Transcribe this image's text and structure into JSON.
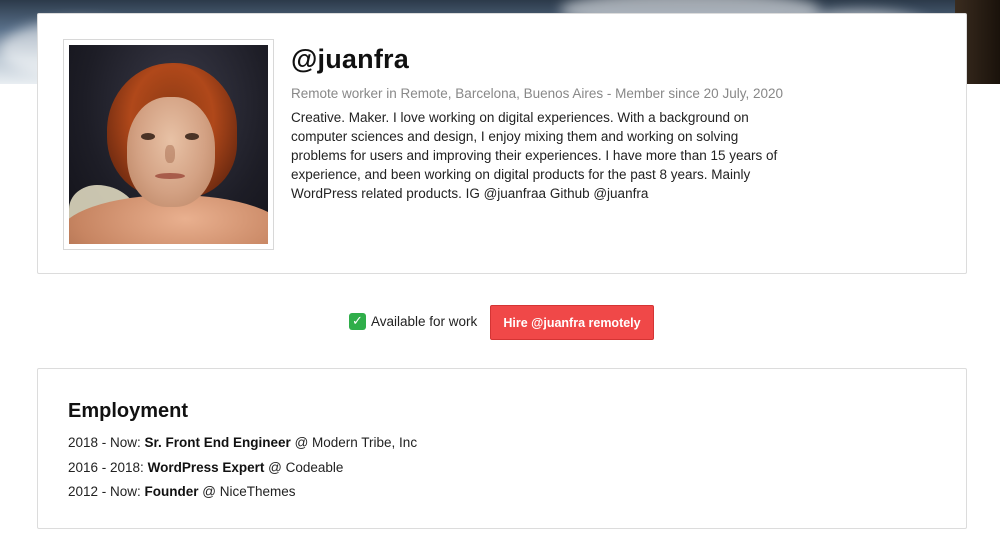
{
  "profile": {
    "username": "@juanfra",
    "meta": "Remote worker in Remote, Barcelona, Buenos Aires - Member since 20 July, 2020",
    "bio": "Creative. Maker. I love working on digital experiences. With a background on computer sciences and design, I enjoy mixing them and working on solving problems for users and improving their experiences. I have more than 15 years of experience, and been working on digital products for the past 8 years. Mainly WordPress related products. IG @juanfraa Github @juanfra"
  },
  "hire": {
    "availability_icon": "check-icon",
    "availability_label": "Available for work",
    "button_label": "Hire @juanfra remotely",
    "button_color": "#f04848"
  },
  "employment": {
    "title": "Employment",
    "items": [
      {
        "period": "2018 - Now: ",
        "role": "Sr. Front End Engineer",
        "company": " @ Modern Tribe, Inc"
      },
      {
        "period": "2016 - 2018: ",
        "role": "WordPress Expert",
        "company": " @ Codeable"
      },
      {
        "period": "2012 - Now: ",
        "role": "Founder",
        "company": " @ NiceThemes"
      }
    ]
  }
}
